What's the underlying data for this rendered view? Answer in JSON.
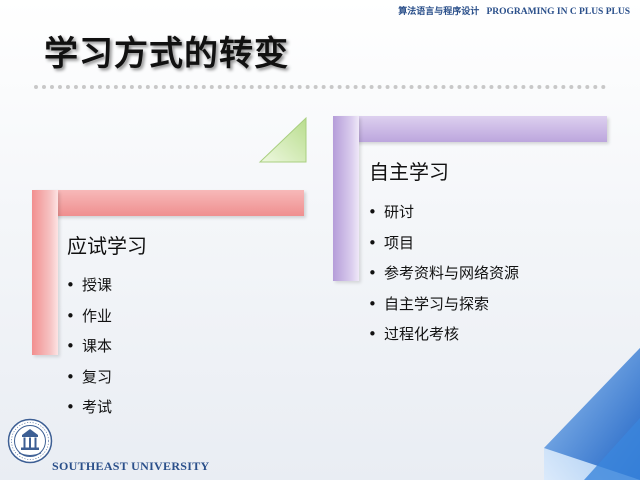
{
  "header": {
    "course_cn": "算法语言与程序设计",
    "course_en": "PROGRAMING IN C PLUS PLUS"
  },
  "title": "学习方式的转变",
  "left_panel": {
    "heading": "应试学习",
    "items": [
      "授课",
      "作业",
      "课本",
      "复习",
      "考试"
    ]
  },
  "right_panel": {
    "heading": "自主学习",
    "items": [
      "研讨",
      "项目",
      "参考资料与网络资源",
      "自主学习与探索",
      "过程化考核"
    ]
  },
  "bullet_char": "•",
  "footer": {
    "university": "SOUTHEAST UNIVERSITY"
  },
  "colors": {
    "pink": "#f29a9a",
    "purple": "#c4b0e2",
    "green": "#c9e6a8",
    "blue": "#2f7bd6",
    "brand_text": "#2a4f8a"
  },
  "icons": {
    "logo": "southeast-university-emblem"
  }
}
